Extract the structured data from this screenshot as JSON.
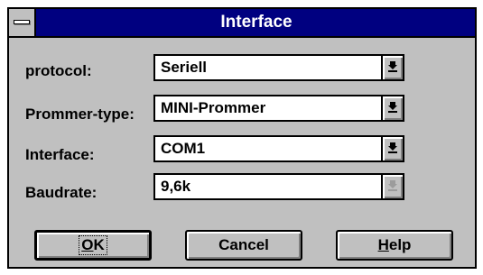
{
  "window": {
    "title": "Interface"
  },
  "fields": [
    {
      "label": "protocol:",
      "value": "Seriell"
    },
    {
      "label": "Prommer-type:",
      "value": "MINI-Prommer"
    },
    {
      "label": "Interface:",
      "value": "COM1"
    },
    {
      "label": "Baudrate:",
      "value": "9,6k"
    }
  ],
  "buttons": {
    "ok": {
      "label_mnemonic": "O",
      "label_rest": "K"
    },
    "cancel": {
      "label": "Cancel"
    },
    "help": {
      "label_mnemonic": "H",
      "label_rest": "elp"
    }
  },
  "icons": {
    "system_menu": "system-menu-icon",
    "dropdown": "dropdown-arrow-icon"
  },
  "colors": {
    "titlebar": "#000080",
    "face": "#c0c0c0"
  }
}
